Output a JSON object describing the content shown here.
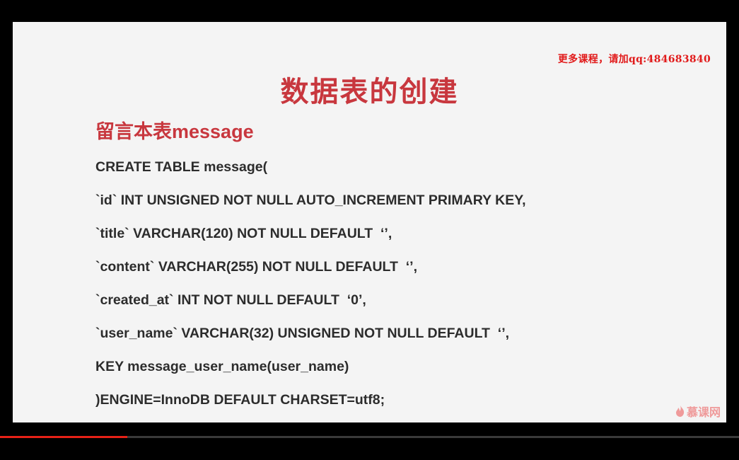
{
  "promo": {
    "text": "更多课程，请加qq:484683840",
    "color": "#e11b1b"
  },
  "slide": {
    "title": "数据表的创建",
    "heading": "留言本表message",
    "accent_color": "#c8373e",
    "code_lines": [
      "CREATE TABLE message(",
      "`id` INT UNSIGNED NOT NULL AUTO_INCREMENT PRIMARY KEY,",
      "`title` VARCHAR(120) NOT NULL DEFAULT  ‘’,",
      "`content` VARCHAR(255) NOT NULL DEFAULT  ‘’,",
      "`created_at` INT NOT NULL DEFAULT  ‘0’,",
      "`user_name` VARCHAR(32) UNSIGNED NOT NULL DEFAULT  ‘’,",
      "KEY message_user_name(user_name)",
      ")ENGINE=InnoDB DEFAULT CHARSET=utf8;"
    ],
    "watermark": {
      "icon": "flame-icon",
      "text": "慕课网"
    }
  },
  "player": {
    "progress_fraction": 0.172,
    "progress_color": "#e62117"
  }
}
